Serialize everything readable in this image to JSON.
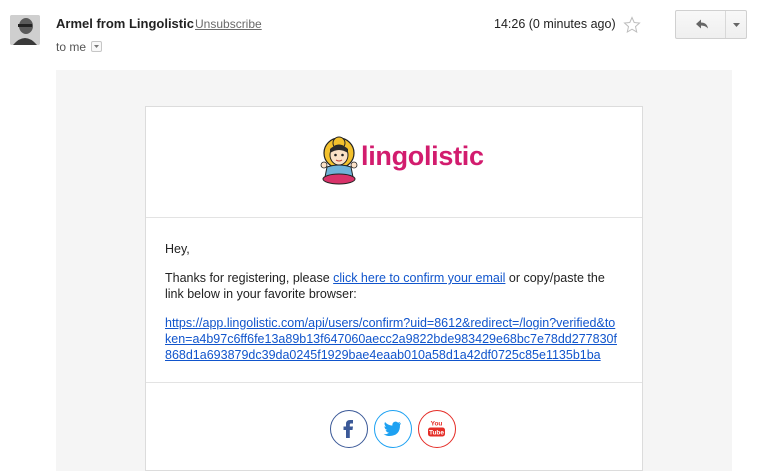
{
  "header": {
    "sender": "Armel from Lingolistic",
    "unsubscribe": "Unsubscribe",
    "recipient": "to me",
    "time": "14:26 (0 minutes ago)"
  },
  "email": {
    "brand": "lingolistic",
    "greeting": "Hey,",
    "para_before": "Thanks for registering, please ",
    "confirm_link": "click here to confirm your email",
    "para_after": " or copy/paste the link below in your favorite browser:",
    "confirm_url": "https://app.lingolistic.com/api/users/confirm?uid=8612&redirect=/login?verified&token=a4b97c6ff6fe13a89b13f647060aecc2a9822bde983429e68bc7e78dd277830f868d1a693879dc39da0245f1929bae4eaab010a58d1a42df0725c85e1135b1ba"
  },
  "social": {
    "youtube_label": "You Tube"
  },
  "colors": {
    "brand": "#d21c6e",
    "link": "#1155cc",
    "facebook": "#3b5998",
    "twitter": "#1da1f2",
    "youtube": "#e52d27"
  },
  "icons": [
    "avatar",
    "caret-down-icon",
    "star-icon",
    "reply-icon",
    "more-options-icon",
    "mascot-logo",
    "facebook-icon",
    "twitter-icon",
    "youtube-icon"
  ]
}
